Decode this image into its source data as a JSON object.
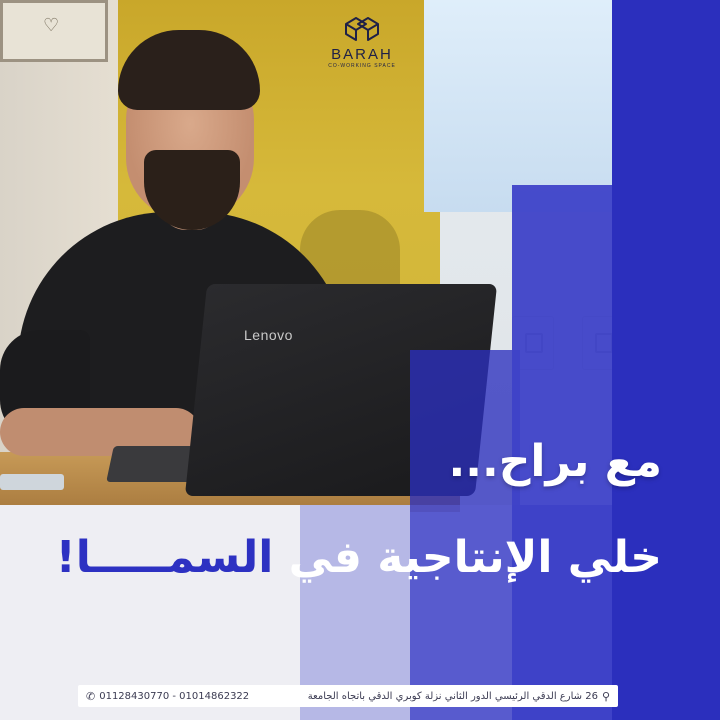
{
  "brand": {
    "name": "BARAH",
    "tagline": "CO-WORKING SPACE",
    "logo_icon": "barah-cube-logo"
  },
  "photo": {
    "laptop_brand": "Lenovo"
  },
  "headline": {
    "line1": "مع براح...",
    "line2_white": "خلي الإنتاجية في",
    "line2_accent": "السمـــــا!"
  },
  "footer": {
    "phones": "01128430770 - 01014862322",
    "phone_icon": "phone-icon",
    "address": "26 شارع الدقي الرئيسي الدور الثاني نزلة كوبري الدقي باتجاه الجامعة",
    "location_icon": "location-pin-icon"
  },
  "colors": {
    "brand_blue": "#2b2fbd",
    "accent_text": "#2d31c2",
    "wall_yellow": "#d6b93a"
  }
}
